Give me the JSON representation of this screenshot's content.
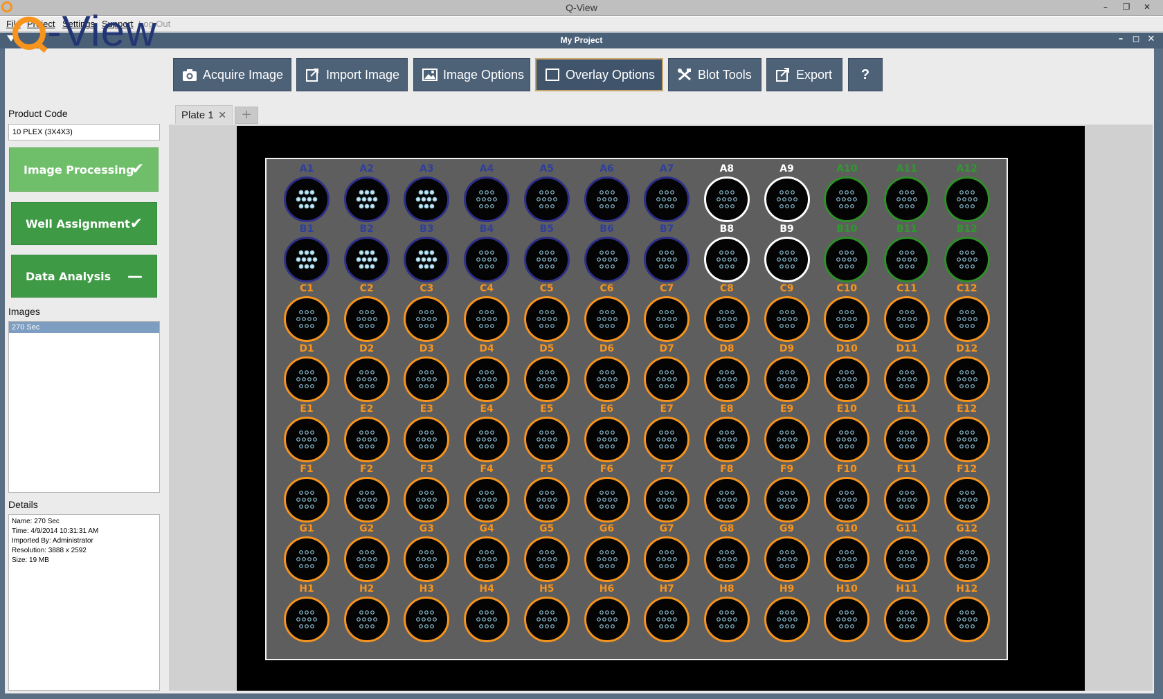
{
  "window": {
    "title": "Q-View",
    "controls": [
      "–",
      "❐",
      "✕"
    ]
  },
  "menu": [
    {
      "label": "File",
      "enabled": true
    },
    {
      "label": "Project",
      "enabled": true
    },
    {
      "label": "Settings",
      "enabled": true
    },
    {
      "label": "Support",
      "enabled": true
    },
    {
      "label": "Log Out",
      "enabled": false
    }
  ],
  "document": {
    "title": "My Project",
    "controls": [
      "–",
      "◻",
      "✕"
    ]
  },
  "logo": {
    "text": "-View"
  },
  "toolbar": [
    {
      "label": "Acquire Image",
      "icon": "camera-icon"
    },
    {
      "label": "Import Image",
      "icon": "import-icon"
    },
    {
      "label": "Image Options",
      "icon": "image-icon"
    },
    {
      "label": "Overlay Options",
      "icon": "overlay-icon",
      "active": true
    },
    {
      "label": "Blot Tools",
      "icon": "tools-icon"
    },
    {
      "label": "Export",
      "icon": "export-icon"
    },
    {
      "label": "?",
      "icon": "help-icon"
    }
  ],
  "sidebar": {
    "product_label": "Product Code",
    "product_value": "10 PLEX (3X4X3)",
    "steps": [
      {
        "label": "Image Processing",
        "mark": "✔"
      },
      {
        "label": "Well Assignment",
        "mark": "✔"
      },
      {
        "label": "Data Analysis",
        "mark": "—"
      }
    ],
    "images_label": "Images",
    "images": [
      "270 Sec"
    ],
    "details_label": "Details",
    "details": [
      "Name: 270 Sec",
      "Time: 4/9/2014 10:31:31 AM",
      "Imported By: Administrator",
      "Resolution: 3888 x 2592",
      "Size: 19 MB"
    ]
  },
  "tabs": [
    {
      "label": "Plate 1",
      "close": "✕"
    }
  ],
  "tab_add": "+",
  "plate": {
    "rows": [
      "A",
      "B",
      "C",
      "D",
      "E",
      "F",
      "G",
      "H"
    ],
    "columns": [
      "1",
      "2",
      "3",
      "4",
      "5",
      "6",
      "7",
      "8",
      "9",
      "10",
      "11",
      "12"
    ],
    "colors": {
      "orange": "#f7941d",
      "blue": "#2e2f88",
      "white": "#ffffff",
      "green": "#2f8f2a",
      "spot": "#8fc5da"
    },
    "well_groups": {
      "blue": [
        "A1",
        "A2",
        "A3",
        "A4",
        "A5",
        "A6",
        "A7",
        "B1",
        "B2",
        "B3",
        "B4",
        "B5",
        "B6",
        "B7"
      ],
      "white": [
        "A8",
        "A9",
        "B8",
        "B9"
      ],
      "green": [
        "A10",
        "A11",
        "A12",
        "B10",
        "B11",
        "B12"
      ]
    }
  }
}
